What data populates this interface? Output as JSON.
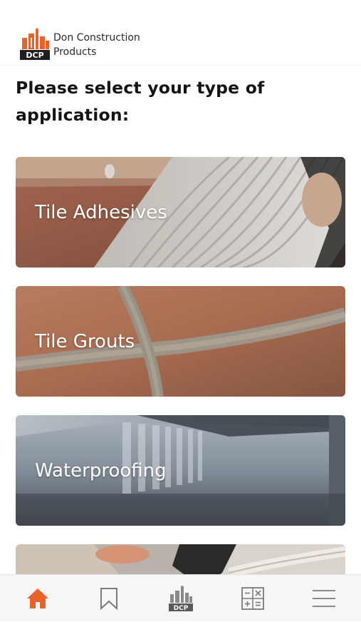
{
  "header": {
    "brand_line1": "Don Construction",
    "brand_line2": "Products",
    "logo_icon": "dcp-logo"
  },
  "prompt": {
    "line1": "Please select your type of",
    "line2": "application:"
  },
  "applications": [
    {
      "label": "Tile Adhesives"
    },
    {
      "label": "Tile Grouts"
    },
    {
      "label": "Waterproofing"
    }
  ],
  "bottom_nav": {
    "items": [
      {
        "icon": "home-icon",
        "active": true
      },
      {
        "icon": "bookmark-icon",
        "active": false
      },
      {
        "icon": "dcp-logo-icon",
        "active": false
      },
      {
        "icon": "calculator-icon",
        "active": false
      },
      {
        "icon": "menu-icon",
        "active": false
      }
    ]
  },
  "colors": {
    "accent": "#e8632b",
    "text_dark": "#141414",
    "icon_gray": "#7a7a7a",
    "nav_bg": "#f6f6f6"
  }
}
